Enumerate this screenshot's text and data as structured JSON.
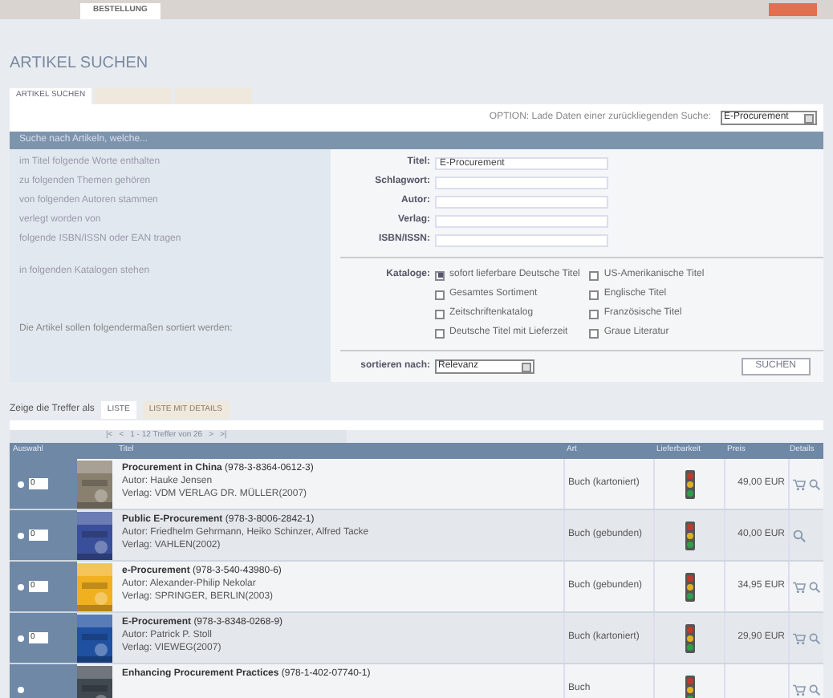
{
  "top_nav": {
    "tabs": [
      {
        "label": "BESTELLUNG",
        "selected": true
      }
    ]
  },
  "heading": "ARTIKEL SUCHEN",
  "tabs": [
    {
      "label": "ARTIKEL SUCHEN",
      "selected": true
    },
    {
      "selected": false
    },
    {
      "selected": false
    }
  ],
  "option": {
    "label": "OPTION: Lade Daten einer zurückliegenden Suche:",
    "value": "E-Procurement"
  },
  "search_panel": {
    "header": "Suche nach Artikeln, welche...",
    "criteria": [
      "im Titel folgende Worte enthalten",
      "zu folgenden Themen gehören",
      "von folgenden Autoren stammen",
      "verlegt worden von",
      "folgende ISBN/ISSN oder EAN tragen"
    ],
    "catalog_hint": "in folgenden Katalogen stehen",
    "sort_hint": "Die Artikel sollen folgendermaßen sortiert werden:",
    "fields": [
      {
        "label": "Titel:",
        "value": "E-Procurement"
      },
      {
        "label": "Schlagwort:"
      },
      {
        "label": "Autor:"
      },
      {
        "label": "Verlag:"
      },
      {
        "label": "ISBN/ISSN:"
      }
    ],
    "catalog_label": "Kataloge:",
    "catalogs": [
      {
        "label": "sofort lieferbare Deutsche Titel",
        "checked": true
      },
      {
        "label": "US-Amerikanische Titel",
        "checked": false
      },
      {
        "label": "Gesamtes Sortiment",
        "checked": false
      },
      {
        "label": "Englische Titel",
        "checked": false
      },
      {
        "label": "Zeitschriftenkatalog",
        "checked": false
      },
      {
        "label": "Französische Titel",
        "checked": false
      },
      {
        "label": "Deutsche Titel mit Lieferzeit",
        "checked": false
      },
      {
        "label": "Graue Literatur",
        "checked": false
      }
    ],
    "sort_label": "sortieren nach:",
    "sort_value": "Relevanz",
    "search_button": "SUCHEN"
  },
  "view": {
    "label": "Zeige die Treffer als",
    "options": [
      {
        "label": "LISTE",
        "selected": true
      },
      {
        "label": "LISTE MIT DETAILS",
        "selected": false
      }
    ]
  },
  "pager": {
    "first": "|<",
    "prev": "<",
    "info": "1 - 12 Treffer von 26",
    "next": ">",
    "last": ">|"
  },
  "table": {
    "columns": [
      "Auswahl",
      "Titel",
      "Art",
      "Lieferbarkeit",
      "Preis",
      "Details"
    ],
    "rows": [
      {
        "qty": "0",
        "title": "Procurement in China",
        "isbn": "(978-3-8364-0612-3)",
        "author": "Autor: Hauke Jensen",
        "publisher": "Verlag: VDM VERLAG DR. MÜLLER(2007)",
        "type": "Buch (kartoniert)",
        "price": "49,00 EUR",
        "cart": true,
        "selected": false
      },
      {
        "qty": "0",
        "title": "Public E-Procurement",
        "isbn": "(978-3-8006-2842-1)",
        "author": "Autor: Friedhelm Gehrmann, Heiko Schinzer, Alfred Tacke",
        "publisher": "Verlag: VAHLEN(2002)",
        "type": "Buch (gebunden)",
        "price": "40,00 EUR",
        "cart": false,
        "selected": false
      },
      {
        "qty": "0",
        "title": "e-Procurement",
        "isbn": "(978-3-540-43980-6)",
        "author": "Autor: Alexander-Philip Nekolar",
        "publisher": "Verlag: SPRINGER, BERLIN(2003)",
        "type": "Buch (gebunden)",
        "price": "34,95 EUR",
        "cart": true,
        "selected": false
      },
      {
        "qty": "0",
        "title": "E-Procurement",
        "isbn": "(978-3-8348-0268-9)",
        "author": "Autor: Patrick P. Stoll",
        "publisher": "Verlag: VIEWEG(2007)",
        "type": "Buch (kartoniert)",
        "price": "29,90 EUR",
        "cart": true,
        "selected": false
      },
      {
        "title": "Enhancing Procurement Practices",
        "isbn": "(978-1-402-07740-1)",
        "type": "Buch",
        "cart": true,
        "selected": false
      }
    ]
  }
}
